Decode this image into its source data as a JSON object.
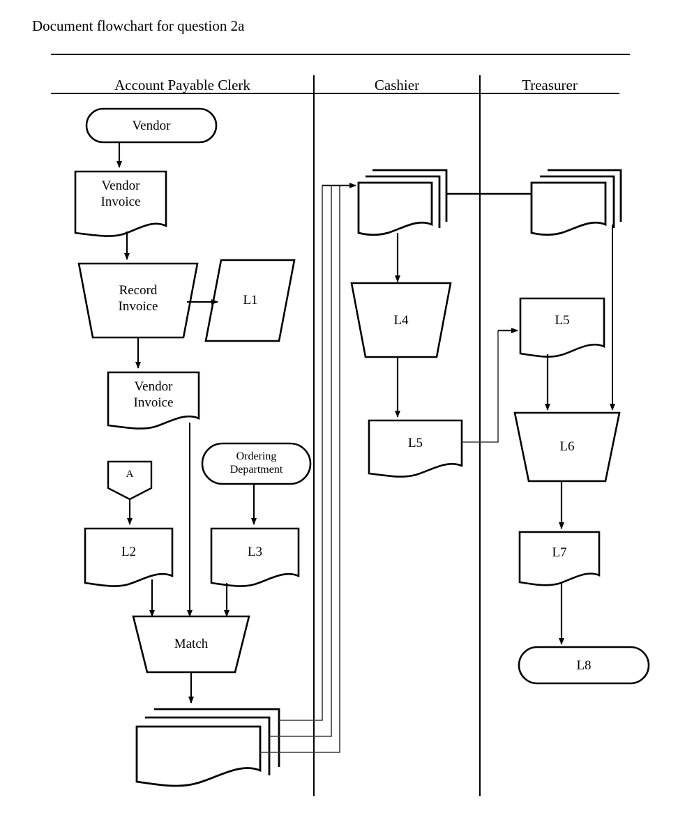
{
  "title": "Document flowchart for question 2a",
  "columns": [
    {
      "id": "account-payable-clerk",
      "label": "Account Payable Clerk"
    },
    {
      "id": "cashier",
      "label": "Cashier"
    },
    {
      "id": "treasurer",
      "label": "Treasurer"
    }
  ],
  "nodes": {
    "vendor": {
      "label": "Vendor",
      "shape": "terminator"
    },
    "vendor_invoice_1": {
      "label": "Vendor\nInvoice",
      "line1": "Vendor",
      "line2": "Invoice",
      "shape": "document"
    },
    "record_invoice": {
      "label": "Record\nInvoice",
      "line1": "Record",
      "line2": "Invoice",
      "shape": "process-trapezoid"
    },
    "l1": {
      "label": "L1",
      "shape": "parallelogram"
    },
    "vendor_invoice_2": {
      "label": "Vendor\nInvoice",
      "line1": "Vendor",
      "line2": "Invoice",
      "shape": "document"
    },
    "connector_a": {
      "label": "A",
      "shape": "offpage-connector"
    },
    "ordering_department": {
      "label": "Ordering\nDepartment",
      "line1": "Ordering",
      "line2": "Department",
      "shape": "terminator"
    },
    "l2": {
      "label": "L2",
      "shape": "document"
    },
    "l3": {
      "label": "L3",
      "shape": "document"
    },
    "match": {
      "label": "Match",
      "shape": "process-trapezoid"
    },
    "matched_docs": {
      "label": "",
      "shape": "multi-document"
    },
    "cashier_docs": {
      "label": "",
      "shape": "multi-document"
    },
    "l4": {
      "label": "L4",
      "shape": "process-trapezoid"
    },
    "l5_cashier": {
      "label": "L5",
      "shape": "document"
    },
    "treasurer_docs": {
      "label": "",
      "shape": "multi-document"
    },
    "l5_treasurer": {
      "label": "L5",
      "shape": "document"
    },
    "l6": {
      "label": "L6",
      "shape": "process-trapezoid"
    },
    "l7": {
      "label": "L7",
      "shape": "document"
    },
    "l8": {
      "label": "L8",
      "shape": "terminator"
    }
  },
  "colors": {
    "stroke": "#000000",
    "thin_stroke": "#3a3a3a",
    "background": "#ffffff"
  }
}
